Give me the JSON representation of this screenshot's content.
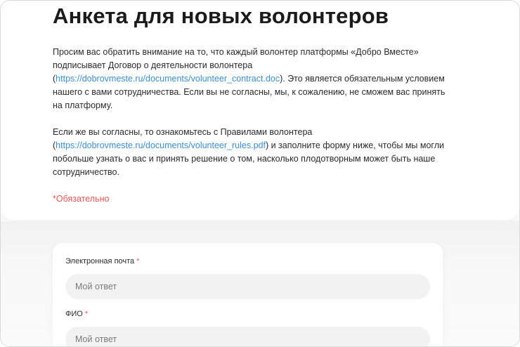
{
  "page": {
    "title": "Анкета для новых волонтеров"
  },
  "intro": {
    "p1_before_link": "Просим вас обратить внимание на то, что каждый волонтер платформы «Добро Вместе» подписывает Договор о деятельности волонтера (",
    "p1_link": "https://dobrovmeste.ru/documents/volunteer_contract.doc",
    "p1_after_link": "). Это является обязательным условием нашего с вами сотрудничества. Если вы не согласны, мы, к сожалению, не сможем вас принять на платформу.",
    "p2_before_link": "Если же вы согласны, то ознакомьтесь с Правилами волонтера (",
    "p2_link": "https://dobrovmeste.ru/documents/volunteer_rules.pdf",
    "p2_after_link": ") и заполните форму ниже, чтобы мы могли побольше узнать о вас и принять решение о том, насколько плодотворным может быть наше сотрудничество.",
    "required_note": "*Обязательно"
  },
  "form": {
    "fields": [
      {
        "label": "Электронная почта",
        "required_mark": "*",
        "value": "",
        "placeholder": "Мой ответ"
      },
      {
        "label": "ФИО",
        "required_mark": "*",
        "value": "",
        "placeholder": "Мой ответ"
      }
    ]
  },
  "colors": {
    "link": "#3b8fcf",
    "required": "#e45757",
    "input_bg": "#f2f2f2",
    "page_bottom_bg": "#f3f3f3"
  }
}
